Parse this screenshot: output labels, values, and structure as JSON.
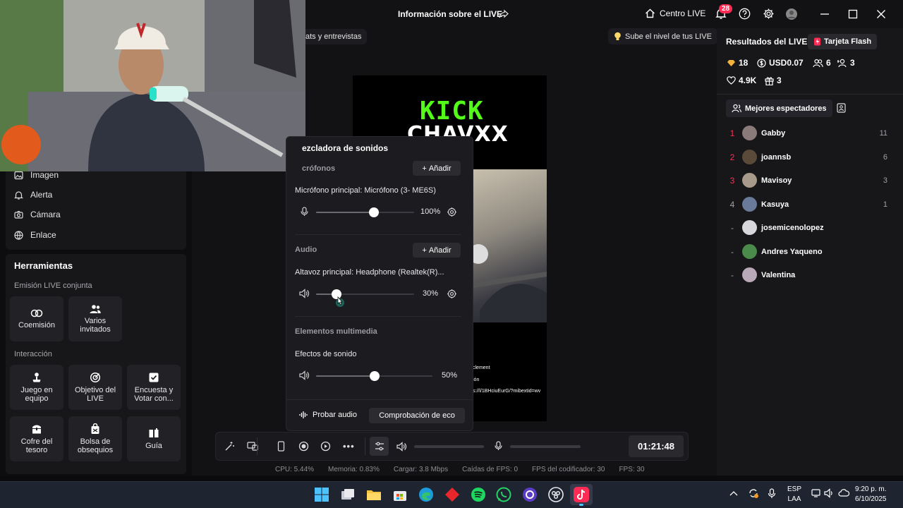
{
  "header": {
    "title": "Información sobre el LIVE",
    "centro_label": "Centro LIVE",
    "notification_count": "28"
  },
  "chips": {
    "chats": "ats y entrevistas",
    "sube": "Sube el nivel de tus LIVE"
  },
  "sources": [
    {
      "label": "Imagen",
      "icon": "image-icon"
    },
    {
      "label": "Alerta",
      "icon": "bell-icon"
    },
    {
      "label": "Cámara",
      "icon": "camera-icon"
    },
    {
      "label": "Enlace",
      "icon": "globe-icon"
    }
  ],
  "tools": {
    "title": "Herramientas",
    "section_cohost": "Emisión LIVE conjunta",
    "cohost_items": [
      "Coemisión",
      "Varios invitados"
    ],
    "section_interaction": "Interacción",
    "interaction_items": [
      "Juego en equipo",
      "Objetivo del LIVE",
      "Encuesta y Votar con...",
      "Cofre del tesoro",
      "Bolsa de obsequios",
      "Guía"
    ]
  },
  "preview": {
    "kick_text": "KICK",
    "channel_text": "CHAVXX",
    "overlay_line1": "clement",
    "overlay_line2": "ión",
    "overlay_line3": "s://l/1BHciuEurG/?mibextid=wv"
  },
  "mixer": {
    "title": "ezcladora de sonidos",
    "mics_section": "crófonos",
    "add_label": "Añadir",
    "mic_name": "Micrófono principal: Micrófono (3- ME6S)",
    "mic_volume": 100,
    "mic_volume_label": "100%",
    "audio_section": "Audio",
    "speaker_name": "Altavoz principal: Headphone (Realtek(R)...",
    "speaker_volume": 30,
    "speaker_volume_label": "30%",
    "media_section": "Elementos multimedia",
    "effects_name": "Efectos de sonido",
    "effects_volume": 50,
    "effects_volume_label": "50%",
    "test_audio": "Probar audio",
    "echo_check": "Comprobación de eco"
  },
  "controls": {
    "timer": "01:21:48"
  },
  "stats": [
    "CPU: 5.44%",
    "Memoria: 0.83%",
    "Cargar: 3.8 Mbps",
    "Caídas de FPS: 0",
    "FPS del codificador: 30",
    "FPS: 30"
  ],
  "results": {
    "title": "Resultados del LIVE",
    "tarjeta": "Tarjeta Flash",
    "diamonds": "18",
    "usd": "USD0.07",
    "viewers": "6",
    "followers": "3",
    "likes": "4.9K",
    "gifts": "3",
    "top_viewers_label": "Mejores espectadores"
  },
  "viewers": [
    {
      "rank": "1",
      "name": "Gabby",
      "count": "11",
      "color": "#fe2c55",
      "avatar": "#8a7a7a"
    },
    {
      "rank": "2",
      "name": "joannsb",
      "count": "6",
      "color": "#fe2c55",
      "avatar": "#5a4a3a"
    },
    {
      "rank": "3",
      "name": "Mavisoy",
      "count": "3",
      "color": "#fe2c55",
      "avatar": "#a89a8a"
    },
    {
      "rank": "4",
      "name": "Kasuya",
      "count": "1",
      "color": "#a0a0a6",
      "avatar": "#6a7a9a"
    },
    {
      "rank": "-",
      "name": "josemicenolopez",
      "count": "",
      "color": "#a0a0a6",
      "avatar": "#d8d8dc"
    },
    {
      "rank": "-",
      "name": "Andres Yaqueno",
      "count": "",
      "color": "#a0a0a6",
      "avatar": "#4a8a4a"
    },
    {
      "rank": "-",
      "name": "Valentina",
      "count": "",
      "color": "#a0a0a6",
      "avatar": "#b8a8b8"
    }
  ],
  "taskbar": {
    "lang_line1": "ESP",
    "lang_line2": "LAA",
    "time": "9:20 p. m.",
    "date": "6/10/2025"
  },
  "colors": {
    "accent": "#fe2c55",
    "kick_green": "#53fc18"
  }
}
